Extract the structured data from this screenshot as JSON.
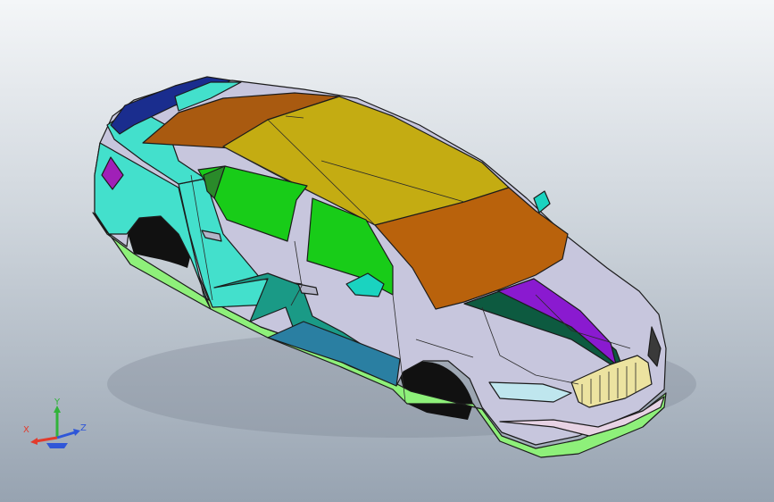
{
  "viewport": {
    "background_top": "#f4f6f8",
    "background_bottom": "#97a3b1"
  },
  "model": {
    "surface_colors": {
      "roof": "#c4ac12",
      "roof_front": "#b9620c",
      "roof_rear": "#a95a10",
      "glass": "#18cc18",
      "body_base": "#c7c6dd",
      "cyan_panel": "#43e0cc",
      "teal_panel": "#1a9a86",
      "blue_panel": "#2a7fa2",
      "spoiler": "#1a2d8e",
      "magenta": "#a020b8",
      "stripe_dark": "#0d5a40",
      "stripe_purple": "#8a1ad0",
      "sill_green": "#8ef07a",
      "grille": "#ece3a0",
      "tire": "#111111"
    }
  },
  "triad": {
    "y_label": "Y",
    "x_label": "X",
    "z_label": "Z",
    "x_color": "#e23b2c",
    "y_color": "#31b33a",
    "z_color": "#2f56d8"
  }
}
